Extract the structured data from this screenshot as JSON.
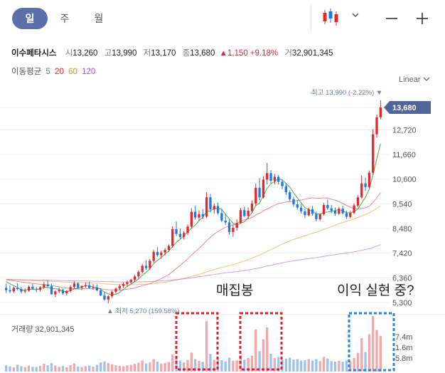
{
  "tabs": [
    {
      "label": "일",
      "active": true
    },
    {
      "label": "주",
      "active": false
    },
    {
      "label": "월",
      "active": false
    }
  ],
  "toolbar": {
    "chart_type_icon": "candlestick-icon",
    "dropdown_icon": "chevron-down-icon",
    "minus_icon": "minus-icon",
    "plus_icon": "plus-icon"
  },
  "stock": {
    "name": "이수페타시스",
    "open_label": "시",
    "open": "13,260",
    "high_label": "고",
    "high": "13,990",
    "low_label": "저",
    "low": "13,170",
    "close_label": "종",
    "close": "13,680",
    "change": "▲1,150",
    "change_pct": "+9.18%",
    "volume_label": "거",
    "volume": "32,901,345"
  },
  "ma": {
    "label": "이동평균",
    "periods": [
      "5",
      "20",
      "60",
      "120"
    ],
    "colors": [
      "#2eaa3c",
      "#e0282e",
      "#f08c00",
      "#9b59e0"
    ]
  },
  "scale_mode": "Linear",
  "annotations": {
    "accumulation": "매집봉",
    "profit_taking": "이익 실현 중?"
  },
  "colors": {
    "up": "#e0282e",
    "down": "#1e78e6",
    "price_tag": "#50669a",
    "highlight_red": "#e0202a",
    "highlight_blue": "#1e88e5"
  },
  "chart_data": {
    "type": "candlestick",
    "price_axis": {
      "ticks": [
        "13,680",
        "12,720",
        "11,660",
        "10,600",
        "9,540",
        "8,480",
        "7,420",
        "6,360",
        "5,300"
      ],
      "ylim": [
        5300,
        14100
      ]
    },
    "high_label": "최고 13,990 (-2.22%) ▼",
    "low_label": "▲ 최저 5,270 (159.58%)",
    "last_price": "13,680",
    "volume": {
      "label": "거래량 32,901,345",
      "ticks": [
        "7.4m",
        "1.6m",
        "5.8m"
      ]
    },
    "ohlc": [
      [
        5930,
        6110,
        5710,
        5830
      ],
      [
        5830,
        6040,
        5690,
        5780
      ],
      [
        5780,
        5990,
        5710,
        5930
      ],
      [
        5930,
        6130,
        5830,
        5880
      ],
      [
        5880,
        5980,
        5690,
        5770
      ],
      [
        5770,
        5920,
        5700,
        5810
      ],
      [
        5810,
        6030,
        5760,
        5980
      ],
      [
        5980,
        6100,
        5860,
        5890
      ],
      [
        5890,
        5960,
        5740,
        5850
      ],
      [
        5850,
        6010,
        5770,
        5950
      ],
      [
        5950,
        6180,
        5880,
        6080
      ],
      [
        6080,
        6260,
        5950,
        6000
      ],
      [
        6000,
        6110,
        5680,
        5650
      ],
      [
        5650,
        5830,
        5530,
        5780
      ],
      [
        5780,
        5940,
        5700,
        5840
      ],
      [
        5840,
        5900,
        5640,
        5690
      ],
      [
        5690,
        5830,
        5610,
        5800
      ],
      [
        5800,
        6050,
        5730,
        5970
      ],
      [
        5970,
        6210,
        5900,
        6120
      ],
      [
        6120,
        6180,
        5890,
        5930
      ],
      [
        5930,
        6050,
        5830,
        6010
      ],
      [
        6010,
        6170,
        5940,
        6050
      ],
      [
        6050,
        6190,
        5890,
        5920
      ],
      [
        5920,
        6090,
        5840,
        5950
      ],
      [
        5950,
        6080,
        5780,
        5820
      ],
      [
        5820,
        5920,
        5580,
        5600
      ],
      [
        5600,
        5750,
        5380,
        5430
      ],
      [
        5430,
        5620,
        5270,
        5570
      ],
      [
        5570,
        5810,
        5490,
        5760
      ],
      [
        5760,
        5950,
        5690,
        5900
      ],
      [
        5900,
        6080,
        5820,
        6010
      ],
      [
        6010,
        6160,
        5930,
        6100
      ],
      [
        6100,
        6230,
        5980,
        6170
      ],
      [
        6170,
        6320,
        6080,
        6280
      ],
      [
        6280,
        6480,
        6200,
        6420
      ],
      [
        6420,
        6680,
        6330,
        6610
      ],
      [
        6610,
        6960,
        6560,
        6880
      ],
      [
        6880,
        7120,
        6710,
        6780
      ],
      [
        6780,
        7160,
        6700,
        7090
      ],
      [
        7090,
        7560,
        7010,
        7480
      ],
      [
        7480,
        7680,
        7270,
        7330
      ],
      [
        7330,
        7530,
        7180,
        7450
      ],
      [
        7450,
        7640,
        7320,
        7560
      ],
      [
        7560,
        7800,
        7480,
        7730
      ],
      [
        7730,
        8580,
        7660,
        8450
      ],
      [
        8450,
        8790,
        8160,
        8250
      ],
      [
        8250,
        8480,
        8030,
        8120
      ],
      [
        8120,
        8360,
        8010,
        8290
      ],
      [
        8290,
        8650,
        8200,
        8560
      ],
      [
        8560,
        9350,
        8480,
        9200
      ],
      [
        9200,
        9460,
        8860,
        8950
      ],
      [
        8950,
        9260,
        8820,
        9100
      ],
      [
        9100,
        9320,
        8880,
        8990
      ],
      [
        8990,
        10050,
        8930,
        9820
      ],
      [
        9820,
        9960,
        9160,
        9300
      ],
      [
        9300,
        9560,
        9120,
        9450
      ],
      [
        9450,
        9590,
        9070,
        9140
      ],
      [
        9140,
        9310,
        8760,
        8820
      ],
      [
        8820,
        9090,
        8630,
        8740
      ],
      [
        8740,
        8860,
        8210,
        8330
      ],
      [
        8330,
        8640,
        8120,
        8510
      ],
      [
        8510,
        8880,
        8390,
        8720
      ],
      [
        8720,
        9360,
        8680,
        9270
      ],
      [
        9270,
        9420,
        8960,
        9020
      ],
      [
        9020,
        9380,
        8890,
        9240
      ],
      [
        9240,
        9680,
        9160,
        9550
      ],
      [
        9550,
        10410,
        9470,
        10230
      ],
      [
        10230,
        10650,
        9700,
        9820
      ],
      [
        9820,
        10720,
        9770,
        10580
      ],
      [
        10580,
        11300,
        10380,
        10860
      ],
      [
        10860,
        10990,
        10420,
        10530
      ],
      [
        10530,
        10820,
        10380,
        10700
      ],
      [
        10700,
        10790,
        10370,
        10490
      ],
      [
        10490,
        10580,
        10160,
        10300
      ],
      [
        10300,
        10440,
        9920,
        10040
      ],
      [
        10040,
        10120,
        9660,
        9740
      ],
      [
        9740,
        9840,
        9410,
        9520
      ],
      [
        9520,
        9700,
        9290,
        9380
      ],
      [
        9380,
        9540,
        9120,
        9220
      ],
      [
        9220,
        9330,
        8920,
        9050
      ],
      [
        9050,
        9380,
        9000,
        9310
      ],
      [
        9310,
        9450,
        9030,
        9110
      ],
      [
        9110,
        9220,
        8790,
        8880
      ],
      [
        8880,
        9140,
        8820,
        9090
      ],
      [
        9090,
        9580,
        9040,
        9490
      ],
      [
        9490,
        9720,
        9280,
        9350
      ],
      [
        9350,
        9490,
        9140,
        9240
      ],
      [
        9240,
        9380,
        9030,
        9120
      ],
      [
        9120,
        9410,
        9070,
        9330
      ],
      [
        9330,
        9460,
        9080,
        9140
      ],
      [
        9140,
        9250,
        8890,
        8980
      ],
      [
        8980,
        9240,
        8920,
        9150
      ],
      [
        9150,
        9560,
        9100,
        9470
      ],
      [
        9470,
        9910,
        9400,
        9820
      ],
      [
        9820,
        10760,
        9760,
        10420
      ],
      [
        10420,
        10670,
        10100,
        10260
      ],
      [
        10260,
        10970,
        10200,
        10880
      ],
      [
        10880,
        12760,
        10780,
        12530
      ],
      [
        12530,
        13380,
        12380,
        13260
      ],
      [
        13260,
        13990,
        13170,
        13680
      ]
    ],
    "volume_values": [
      2.2,
      1.8,
      1.5,
      2.4,
      1.9,
      1.6,
      2.1,
      1.7,
      1.6,
      2.0,
      2.8,
      2.2,
      3.0,
      2.1,
      1.7,
      1.9,
      1.5,
      2.3,
      2.9,
      1.8,
      1.6,
      1.9,
      2.1,
      1.7,
      2.4,
      3.2,
      3.6,
      3.0,
      2.6,
      2.2,
      2.0,
      1.9,
      2.2,
      2.4,
      2.7,
      3.1,
      3.9,
      2.9,
      3.3,
      4.4,
      3.5,
      2.8,
      3.0,
      3.4,
      6.0,
      5.1,
      3.9,
      3.2,
      4.1,
      6.7,
      4.4,
      3.8,
      3.4,
      17.8,
      6.2,
      4.1,
      4.6,
      4.0,
      3.6,
      4.9,
      3.8,
      3.9,
      5.8,
      4.2,
      4.8,
      5.6,
      14.9,
      7.2,
      11.4,
      15.6,
      6.3,
      4.8,
      5.1,
      4.4,
      4.6,
      4.9,
      4.2,
      4.4,
      3.9,
      4.0,
      4.4,
      3.9,
      4.4,
      3.7,
      5.2,
      4.6,
      3.7,
      3.5,
      3.8,
      3.5,
      3.9,
      3.6,
      4.8,
      6.6,
      11.8,
      6.9,
      13.2,
      19.6,
      14.7,
      12.6
    ]
  }
}
